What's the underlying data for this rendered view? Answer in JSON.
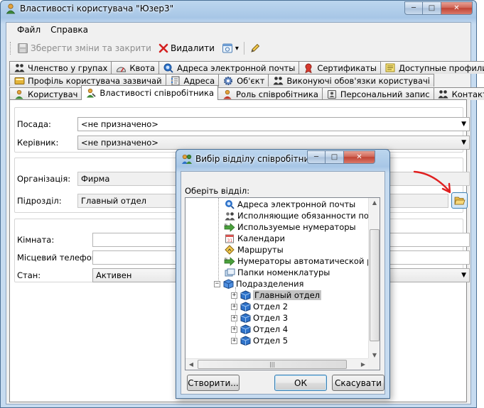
{
  "window": {
    "title": "Властивості користувача \"Юзер3\"",
    "minimize": "─",
    "maximize": "□",
    "close": "✕"
  },
  "menu": [
    "Файл",
    "Справка"
  ],
  "toolbar": {
    "save_close": "Зберегти зміни та закрити",
    "delete": "Видалити",
    "dropdown_arrow": "▾"
  },
  "tabs": {
    "row1": [
      "Членство у групах",
      "Квота",
      "Адреса электронной почты",
      "Сертификаты",
      "Доступные профили"
    ],
    "row2": [
      "Профіль користувача зазвичай",
      "Адреса",
      "Об'єкт",
      "Виконуючі обов'язки користувачі"
    ],
    "row3": [
      "Користувач",
      "Властивості співробітника",
      "Роль співробітника",
      "Персональний запис",
      "Контакти"
    ],
    "active": "Властивості співробітника"
  },
  "form": {
    "position_label": "Посада:",
    "position_value": "<не призначено>",
    "manager_label": "Керівник:",
    "manager_value": "<не призначено>",
    "org_label": "Організація:",
    "org_value": "Фирма",
    "division_label": "Підрозділ:",
    "division_value": "Главный отдел",
    "room_label": "Кімната:",
    "room_value": "",
    "phone_label": "Місцевий телефон:",
    "phone_value": "",
    "state_label": "Стан:",
    "state_value": "Активен"
  },
  "picker": {
    "title": "Вибір відділу співробітника",
    "prompt": "Оберіть відділ:",
    "tree_items": [
      "Адреса электронной почты",
      "Исполняющие обязанности польз",
      "Используемые нумераторы",
      "Календари",
      "Маршруты",
      "Нумераторы автоматической реги",
      "Папки номенклатуры",
      "Подразделения",
      "Главный отдел",
      "Отдел 2",
      "Отдел 3",
      "Отдел 4",
      "Отдел 5"
    ],
    "selected": "Главный отдел",
    "create_button": "Створити...",
    "ok_button": "ОК",
    "cancel_button": "Скасувати",
    "scroll_thumb_glyph": "|||"
  },
  "colors": {
    "frame_blue": "#a7c6e6",
    "annotation_arrow": "#e02020",
    "selection": "#c4c4c4"
  }
}
